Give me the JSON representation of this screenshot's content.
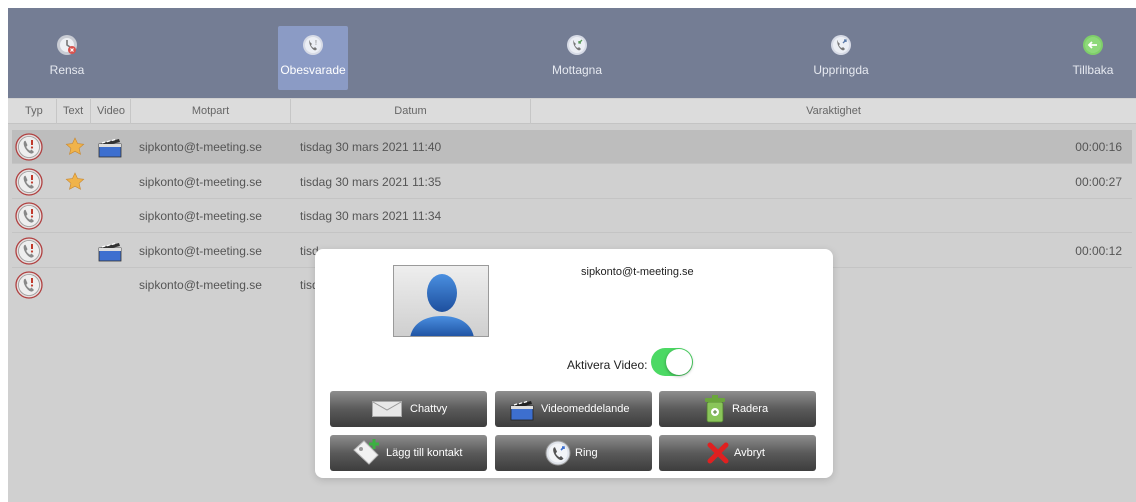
{
  "toolbar": {
    "clear_label": "Rensa",
    "missed_label": "Obesvarade",
    "received_label": "Mottagna",
    "dialed_label": "Uppringda",
    "back_label": "Tillbaka"
  },
  "table": {
    "headers": {
      "type": "Typ",
      "text": "Text",
      "video": "Video",
      "party": "Motpart",
      "date": "Datum",
      "duration": "Varaktighet"
    },
    "rows": [
      {
        "party": "sipkonto@t-meeting.se",
        "date": "tisdag 30 mars 2021 11:40",
        "duration": "00:00:16",
        "has_text": true,
        "has_video": true,
        "selected": true
      },
      {
        "party": "sipkonto@t-meeting.se",
        "date": "tisdag 30 mars 2021 11:35",
        "duration": "00:00:27",
        "has_text": true,
        "has_video": false
      },
      {
        "party": "sipkonto@t-meeting.se",
        "date": "tisdag 30 mars 2021 11:34",
        "duration": "",
        "has_text": false,
        "has_video": false
      },
      {
        "party": "sipkonto@t-meeting.se",
        "date": "tisd",
        "duration": "00:00:12",
        "has_text": false,
        "has_video": true
      },
      {
        "party": "sipkonto@t-meeting.se",
        "date": "tisd",
        "duration": "",
        "has_text": false,
        "has_video": false
      }
    ]
  },
  "dialog": {
    "contact": "sipkonto@t-meeting.se",
    "video_label": "Aktivera Video:",
    "video_enabled": true,
    "buttons": {
      "chat": "Chattvy",
      "video_message": "Videomeddelande",
      "delete": "Radera",
      "add_contact": "Lägg till kontakt",
      "call": "Ring",
      "cancel": "Avbryt"
    }
  },
  "colors": {
    "toolbar": "#747d94",
    "toolbar_active": "#8b9bc5",
    "toggle_on": "#4cd964",
    "background": "#d0d0d0",
    "selected_row": "#bdbdbd"
  }
}
